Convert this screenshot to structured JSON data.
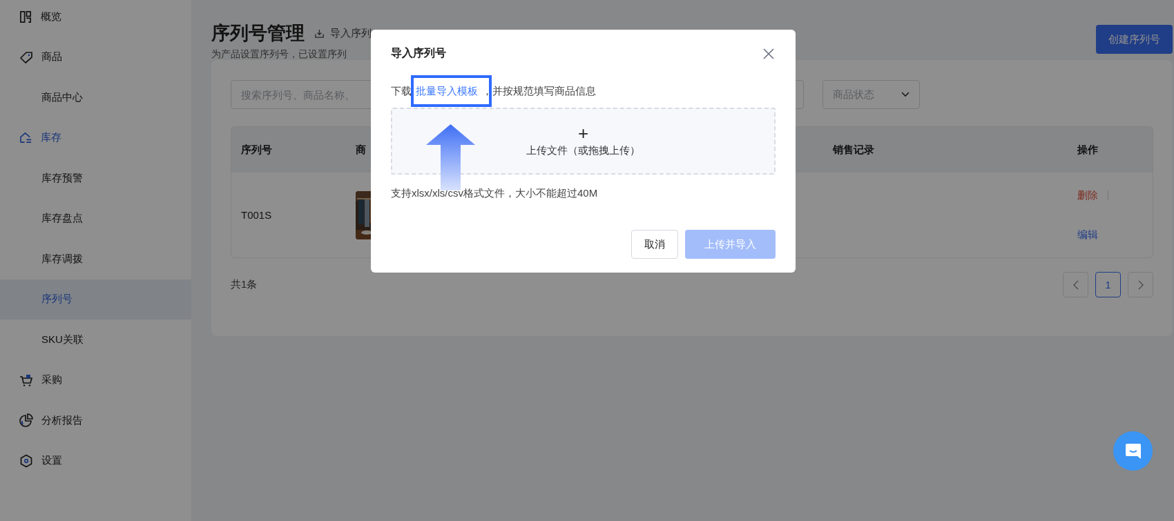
{
  "sidebar": {
    "items": [
      {
        "label": "概览",
        "active": false
      },
      {
        "label": "商品",
        "active": false,
        "children": [
          {
            "label": "商品中心",
            "selected": false
          }
        ]
      },
      {
        "label": "库存",
        "active": true,
        "children": [
          {
            "label": "库存预警",
            "selected": false
          },
          {
            "label": "库存盘点",
            "selected": false
          },
          {
            "label": "库存调拨",
            "selected": false
          },
          {
            "label": "序列号",
            "selected": true
          },
          {
            "label": "SKU关联",
            "selected": false
          }
        ]
      },
      {
        "label": "采购",
        "active": false
      },
      {
        "label": "分析报告",
        "active": false
      },
      {
        "label": "设置",
        "active": false
      }
    ]
  },
  "page": {
    "title": "序列号管理",
    "header_action": "导入序列",
    "subtitle": "为产品设置序列号，已设置序列",
    "create_button": "创建序列号"
  },
  "filters": {
    "search_placeholder": "搜索序列号、商品名称、",
    "status_placeholder": "商品状态"
  },
  "table": {
    "columns": [
      "序列号",
      "商",
      "销售记录",
      "操作"
    ],
    "rows": [
      {
        "serial": "T001S",
        "actions": [
          {
            "label": "删除",
            "kind": "danger"
          },
          {
            "label": "编辑",
            "kind": "link"
          }
        ]
      }
    ]
  },
  "pagination": {
    "total": "共1条",
    "pages": [
      {
        "label": "1",
        "selected": true
      }
    ]
  },
  "dialog": {
    "title": "导入序列号",
    "instruction_before": "下载",
    "instruction_link": "批量导入模板",
    "instruction_after": "，并按规范填写商品信息",
    "upload_plus": "+",
    "upload_label": "上传文件（或拖拽上传）",
    "hint": "支持xlsx/xls/csv格式文件，大小不能超过40M",
    "cancel": "取消",
    "submit": {
      "label": "上传并导入",
      "disabled": true
    }
  }
}
